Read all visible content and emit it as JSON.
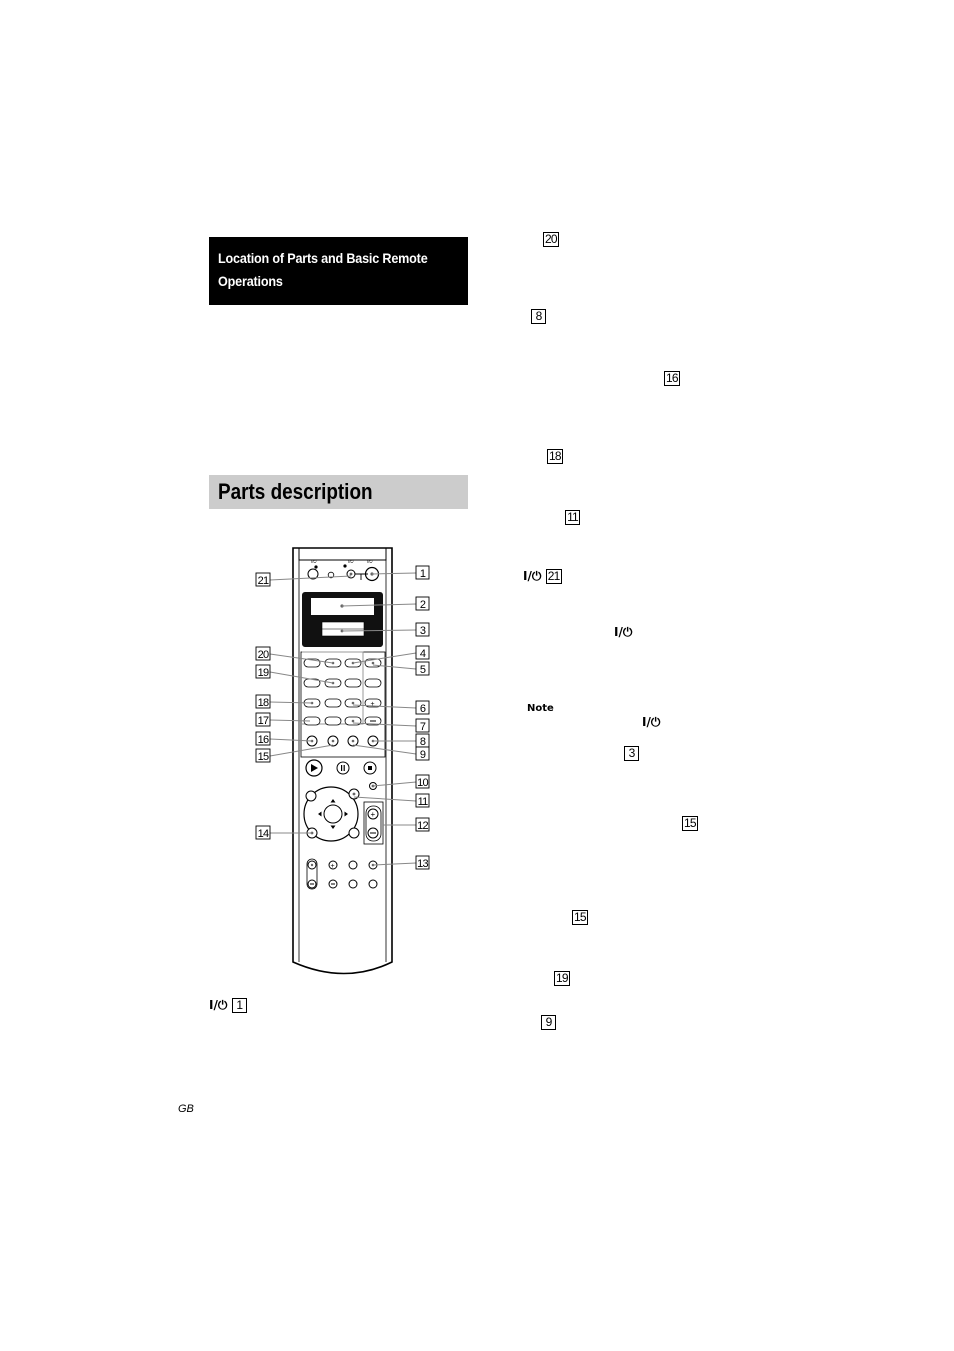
{
  "section": {
    "title_line1": "Location of Parts and Basic Remote",
    "title_line2": "Operations"
  },
  "heading": "Parts description",
  "remote": {
    "callouts_left": [
      "21",
      "20",
      "19",
      "18",
      "17",
      "16",
      "15",
      "14"
    ],
    "callouts_right": [
      "1",
      "2",
      "3",
      "4",
      "5",
      "6",
      "7",
      "8",
      "9",
      "10",
      "11",
      "12",
      "13"
    ],
    "top_button_symbol": "I/⏻"
  },
  "left_column": {
    "power_ref": {
      "symbol": "I/⏻",
      "number": "1"
    }
  },
  "right_column": {
    "refs": [
      {
        "number": "20"
      },
      {
        "number": "8"
      },
      {
        "number": "16"
      },
      {
        "number": "18"
      },
      {
        "number": "11"
      },
      {
        "symbol": "I/⏻",
        "number": "21"
      },
      {
        "symbol": "I/⏻"
      },
      {
        "symbol": "I/⏻"
      },
      {
        "number": "3"
      },
      {
        "number": "15"
      },
      {
        "number": "15"
      },
      {
        "number": "19"
      },
      {
        "number": "9"
      }
    ],
    "note_label": "Note"
  },
  "footer": {
    "page_lang": "GB"
  }
}
